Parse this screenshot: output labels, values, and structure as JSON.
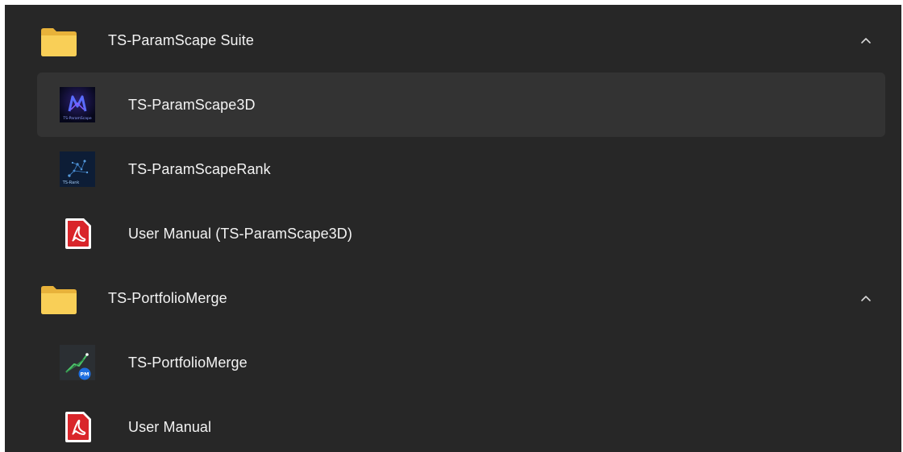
{
  "groups": [
    {
      "label": "TS-ParamScape Suite",
      "icon": "folder-icon",
      "expanded": true,
      "items": [
        {
          "label": "TS-ParamScape3D",
          "icon": "paramscape3d-app-icon",
          "icon_text": "TS-ParamScape"
        },
        {
          "label": "TS-ParamScapeRank",
          "icon": "paramscaperank-app-icon",
          "icon_text": "TS-Rank"
        },
        {
          "label": "User Manual (TS-ParamScape3D)",
          "icon": "pdf-icon"
        }
      ]
    },
    {
      "label": "TS-PortfolioMerge",
      "icon": "folder-icon",
      "expanded": true,
      "items": [
        {
          "label": "TS-PortfolioMerge",
          "icon": "portfoliomerge-app-icon",
          "icon_text": "PM"
        },
        {
          "label": "User Manual",
          "icon": "pdf-icon"
        }
      ]
    }
  ],
  "colors": {
    "background": "#272727",
    "hover": "#333333",
    "text": "#f3f3f3",
    "folder": "#f7c948",
    "pdf_red": "#d9252a"
  }
}
